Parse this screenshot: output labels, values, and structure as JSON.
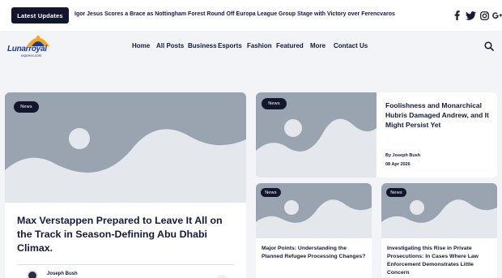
{
  "topbar": {
    "latest_label": "Latest Updates",
    "ticker_text": "Igor Jesus Scores a Brace as Nottingham Forest Round Off Europa League Group Stage with Victory over Ferencvaros",
    "social": [
      "facebook-icon",
      "twitter-icon",
      "instagram-icon",
      "google-plus-icon"
    ]
  },
  "logo": {
    "name": "Lunarroyal",
    "sub": "express.com"
  },
  "nav": {
    "items": [
      "Home",
      "All Posts",
      "Business",
      "Esports",
      "Fashion",
      "Featured",
      "More",
      "Contact Us"
    ]
  },
  "posts": {
    "main": {
      "category": "News",
      "title": "Max Verstappen Prepared to Leave It All on the Track in Season-Defining Abu Dhabi Climax.",
      "author": "Joseph Bush"
    },
    "side": {
      "category": "News",
      "title": "Foolishness and Monarchical Hubris Damaged Andrew, and It Might Persist Yet",
      "byline": "By Joseph Bush",
      "date": "08 Apr 2026"
    },
    "small": [
      {
        "category": "News",
        "title": "Major Points: Understanding the Planned Refugee Processing Changes?"
      },
      {
        "category": "News",
        "title": "Investigating this Rise in Private Prosecutions: In Cases Where Law Enforcement Demonstrates Little Concern"
      }
    ]
  },
  "colors": {
    "dark": "#12172e",
    "text": "#151a3a",
    "placeholder": "#9aa4b1",
    "background": "#f3f4f8"
  }
}
